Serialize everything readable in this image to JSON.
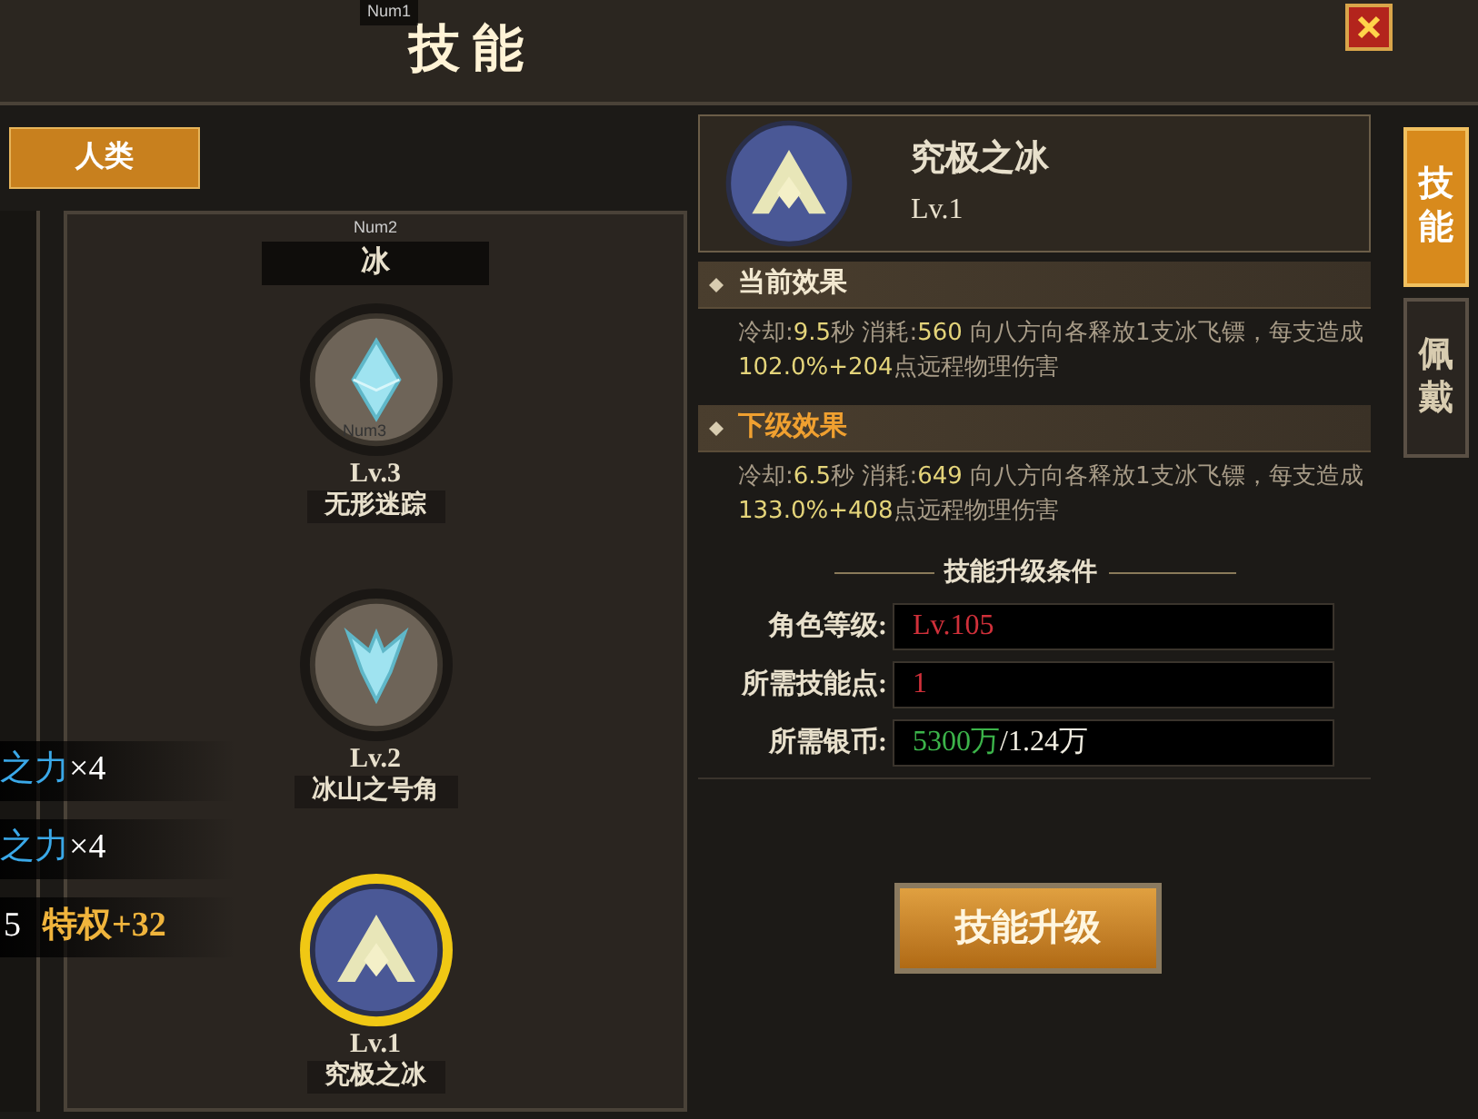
{
  "window": {
    "title": "技 能",
    "debug_label": "Num1"
  },
  "race_tab": {
    "label": "人类",
    "selected": true
  },
  "side_rows": [
    {
      "kind": "power",
      "text": "**之力**×4"
    },
    {
      "kind": "power",
      "text": "**之力**×4"
    },
    {
      "kind": "privilege",
      "prefix": "5",
      "text": "特权+32"
    }
  ],
  "skill_tree": {
    "element": "冰",
    "debug_label": "Num2",
    "skills": [
      {
        "kind": "diamond",
        "level": "Lv.3",
        "name": "无形迷踪",
        "selected": false,
        "learned": false,
        "debug_label": "Num3"
      },
      {
        "kind": "horn",
        "level": "Lv.2",
        "name": "冰山之号角",
        "selected": false,
        "learned": false
      },
      {
        "kind": "peak",
        "level": "Lv.1",
        "name": "究极之冰",
        "selected": true,
        "learned": true
      }
    ]
  },
  "detail": {
    "name": "究极之冰",
    "level": "Lv.1",
    "effects": [
      {
        "title": "当前效果",
        "kind": "current",
        "text": "冷却:**9.5**秒 消耗:**560** 向八方向各释放1支冰飞镖，每支造成**102.0%+204**点远程物理伤害"
      },
      {
        "title": "下级效果",
        "kind": "next",
        "text": "冷却:**6.5**秒 消耗:**649** 向八方向各释放1支冰飞镖，每支造成**133.0%+408**点远程物理伤害"
      }
    ],
    "requirements_title": "技能升级条件",
    "requirements": [
      {
        "label": "角色等级:",
        "value": "Lv.105",
        "met": false
      },
      {
        "label": "所需技能点:",
        "value": "1",
        "met": false
      },
      {
        "label": "所需银币:",
        "value": "**5300万**/1.24万",
        "met": true
      }
    ],
    "upgrade_button": "技能升级"
  },
  "side_tabs": [
    {
      "label": "技能",
      "selected": true
    },
    {
      "label": "佩戴",
      "selected": false
    }
  ]
}
